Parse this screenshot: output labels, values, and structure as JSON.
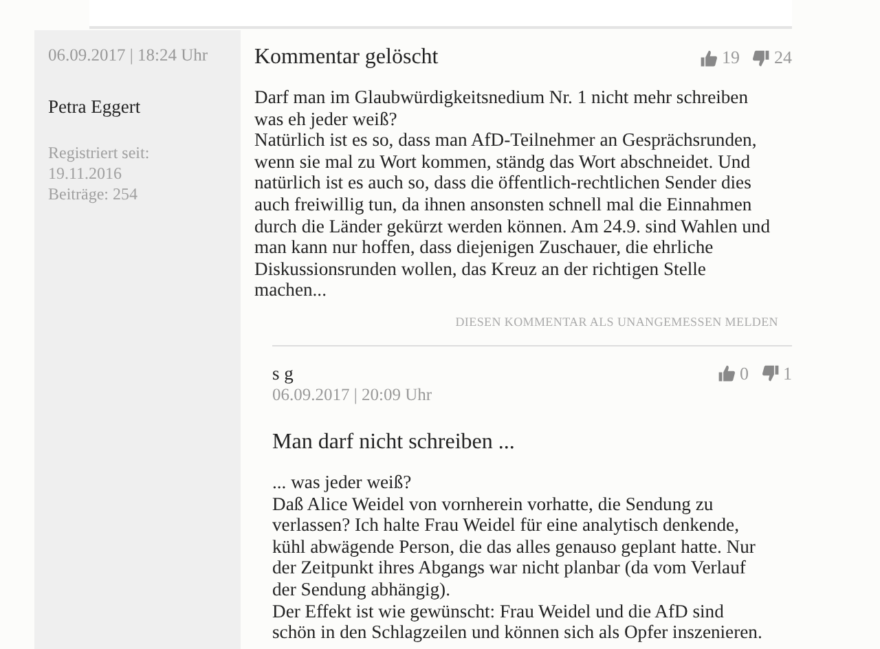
{
  "comment": {
    "date": "06.09.2017 | 18:24 Uhr",
    "author": "Petra Eggert",
    "registered": "Registriert seit: 19.11.2016",
    "posts": "Beiträge: 254",
    "title": "Kommentar gelöscht",
    "likes": "19",
    "dislikes": "24",
    "paragraphs": [
      "Darf man im Glaubwürdigkeitsnedium Nr. 1 nicht mehr schreiben was eh jeder weiß?",
      "Natürlich ist es so, dass man AfD-Teilnehmer an Gesprächsrunden, wenn sie mal zu Wort kommen, ständg das Wort abschneidet. Und natürlich ist es auch so, dass die öffentlich-rechtlichen Sender dies auch freiwillig tun, da ihnen ansonsten schnell mal die Einnahmen durch die Länder gekürzt werden können. Am 24.9. sind Wahlen und man kann nur hoffen, dass diejenigen Zuschauer, die ehrliche Diskussionsrunden wollen, das Kreuz an der richtigen Stelle machen..."
    ],
    "report": "DIESEN KOMMENTAR ALS UNANGEMESSEN MELDEN"
  },
  "reply": {
    "author": "s g",
    "likes": "0",
    "dislikes": "1",
    "date": "06.09.2017 | 20:09 Uhr",
    "title": "Man darf nicht schreiben ...",
    "paragraphs": [
      "... was jeder weiß?",
      "Daß Alice Weidel von vornherein vorhatte, die Sendung zu verlassen? Ich halte Frau Weidel für eine analytisch denkende, kühl abwägende Person, die das alles genauso geplant hatte. Nur der Zeitpunkt ihres Abgangs war nicht planbar (da vom Verlauf der Sendung abhängig).",
      "Der Effekt ist wie gewünscht: Frau Weidel und die AfD sind schön in den Schlagzeilen und können sich als Opfer inszenieren."
    ]
  }
}
